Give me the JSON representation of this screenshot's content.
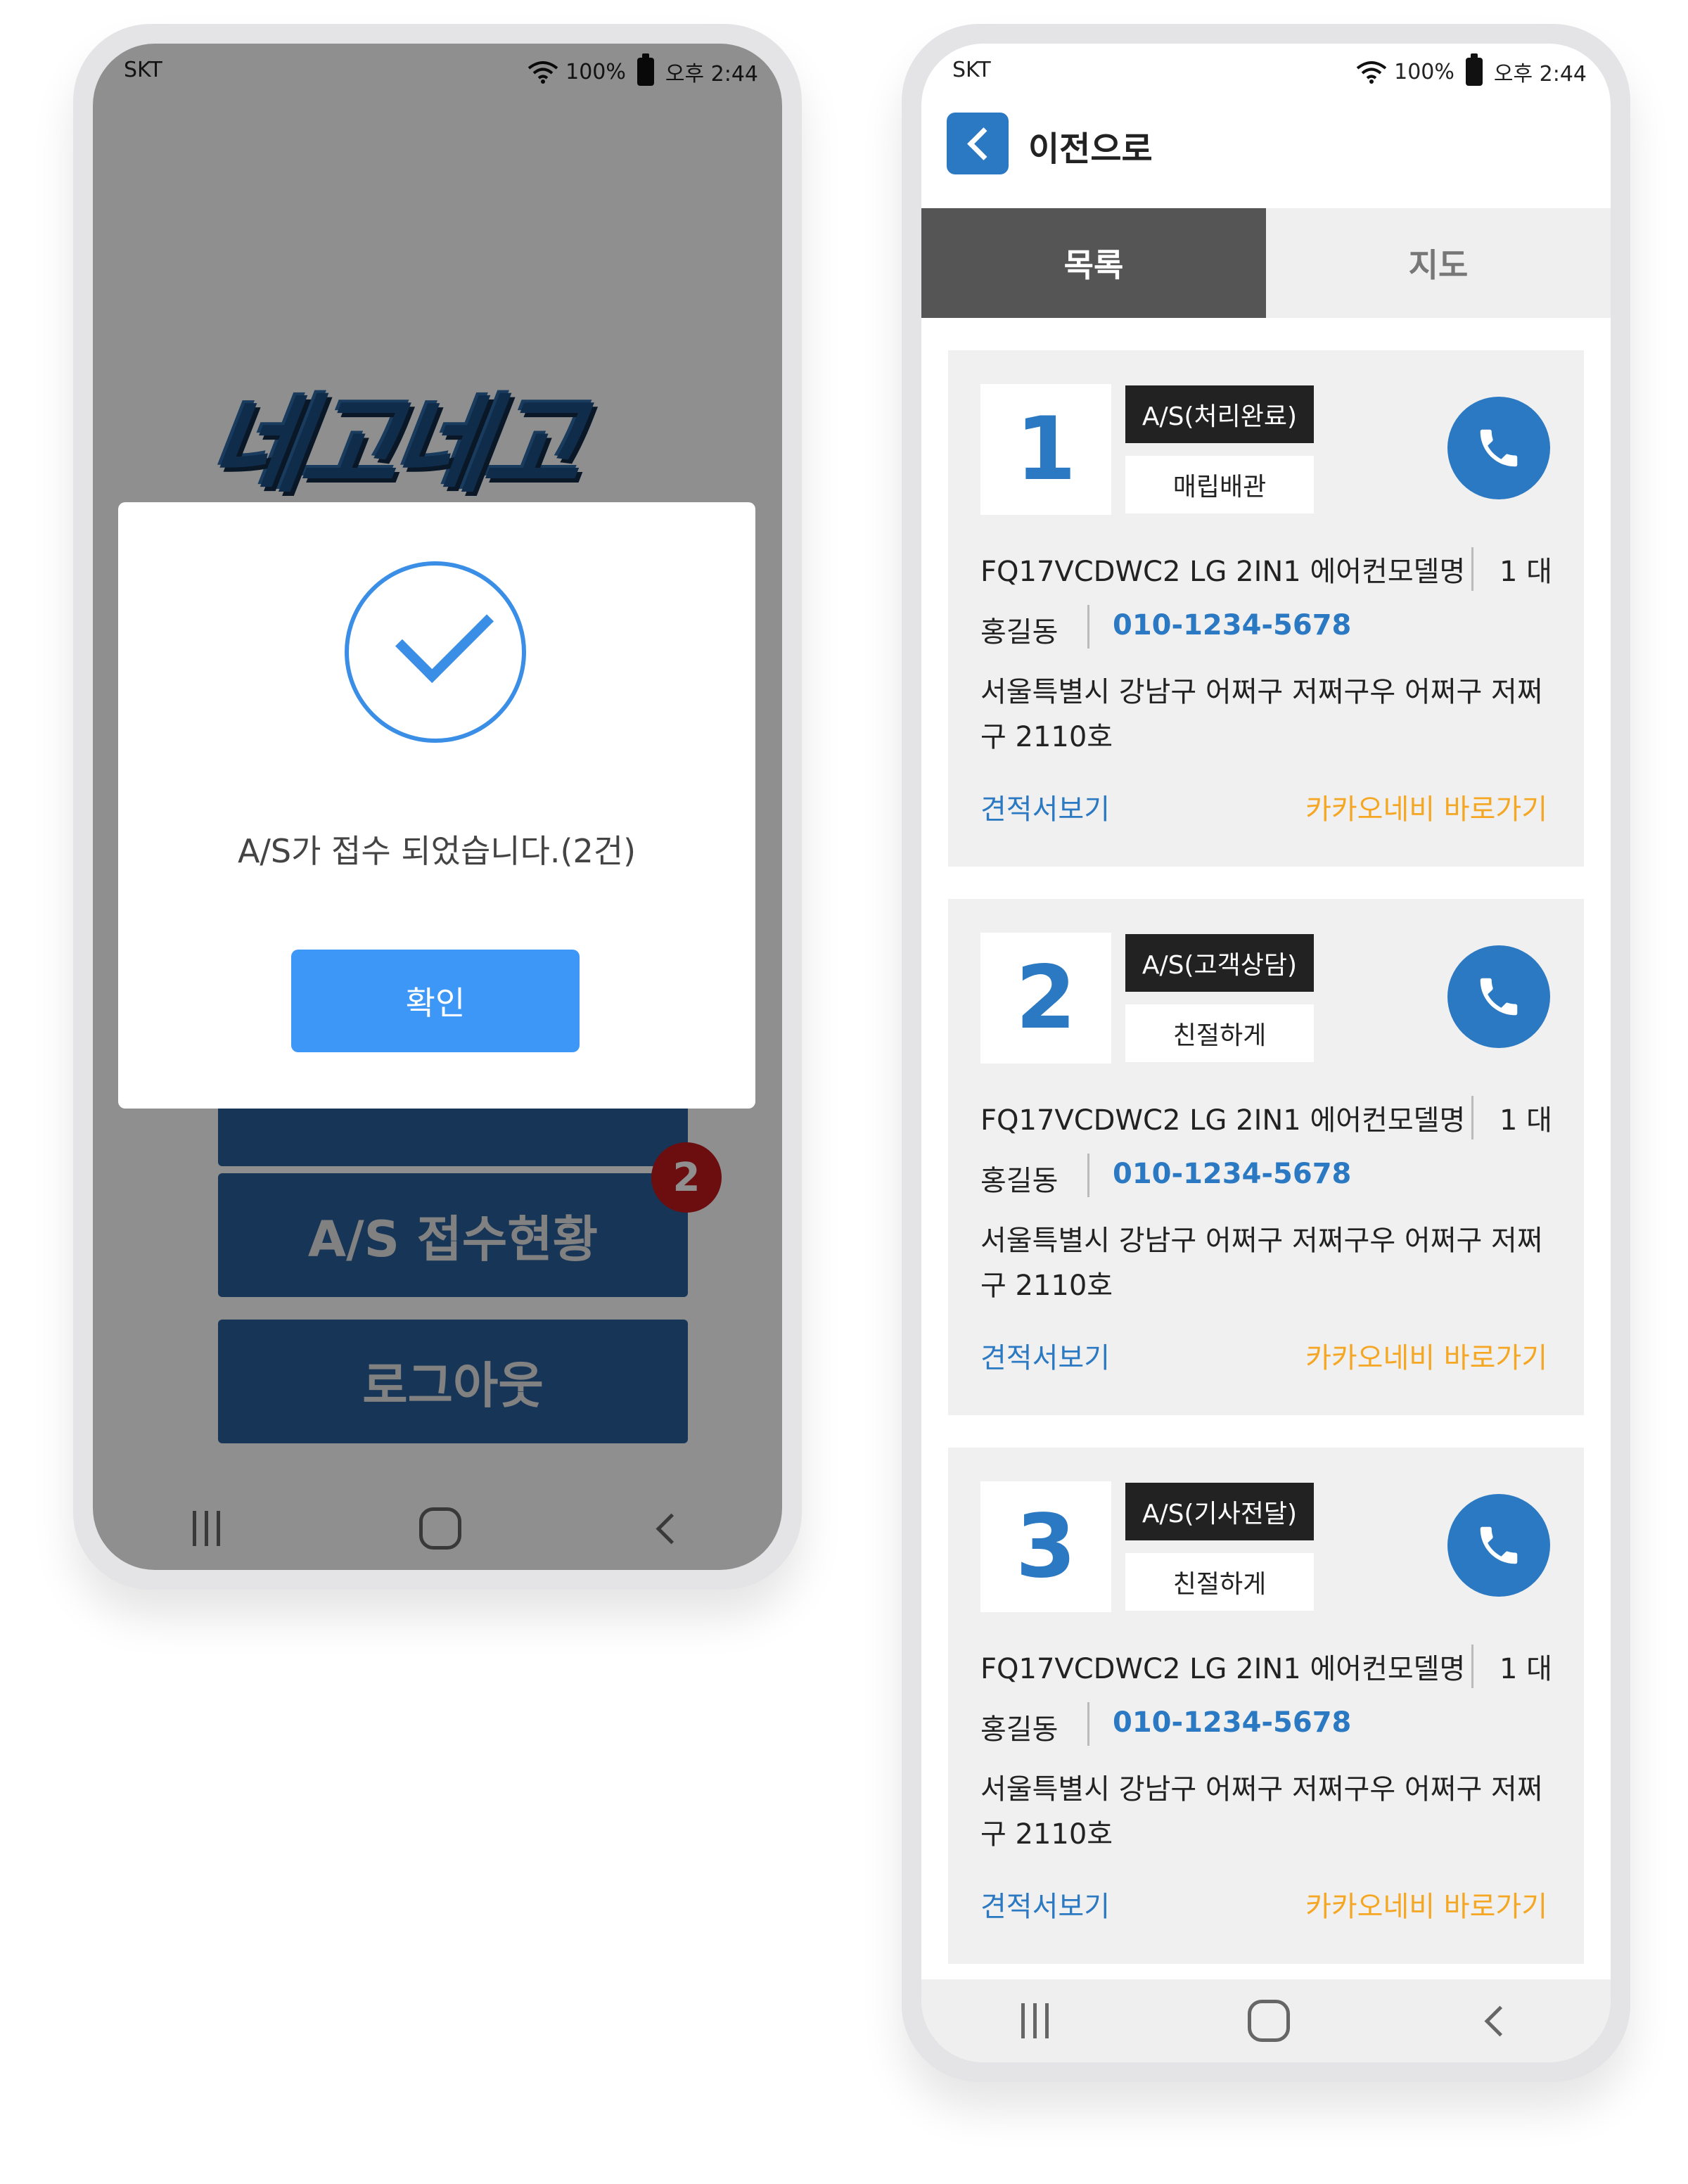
{
  "status_bar": {
    "carrier": "SKT",
    "battery": "100%",
    "time": "오후 2:44"
  },
  "left": {
    "logo": "네고네고",
    "menu": {
      "status_button": "A/S 접수현황",
      "logout_button": "로그아웃",
      "badge_count": "2"
    },
    "dialog": {
      "message": "A/S가 접수 되었습니다.(2건)",
      "confirm_label": "확인"
    }
  },
  "right": {
    "back_label": "이전으로",
    "tabs": [
      {
        "label": "목록"
      },
      {
        "label": "지도"
      }
    ],
    "cards": [
      {
        "number": "1",
        "status": "A/S(처리완료)",
        "type": "매립배관",
        "model": "FQ17VCDWC2 LG 2IN1 에어컨모델명",
        "quantity": "1 대",
        "name": "홍길동",
        "phone": "010-1234-5678",
        "address": "서울특별시 강남구 어쩌구 저쩌구우 어쩌구 저쩌구 2110호",
        "estimate_label": "견적서보기",
        "kakao_label": "카카오네비 바로가기"
      },
      {
        "number": "2",
        "status": "A/S(고객상담)",
        "type": "친절하게",
        "model": "FQ17VCDWC2 LG 2IN1 에어컨모델명",
        "quantity": "1 대",
        "name": "홍길동",
        "phone": "010-1234-5678",
        "address": "서울특별시 강남구 어쩌구 저쩌구우 어쩌구 저쩌구 2110호",
        "estimate_label": "견적서보기",
        "kakao_label": "카카오네비 바로가기"
      },
      {
        "number": "3",
        "status": "A/S(기사전달)",
        "type": "친절하게",
        "model": "FQ17VCDWC2 LG 2IN1 에어컨모델명",
        "quantity": "1 대",
        "name": "홍길동",
        "phone": "010-1234-5678",
        "address": "서울특별시 강남구 어쩌구 저쩌구우 어쩌구 저쩌구 2110호",
        "estimate_label": "견적서보기",
        "kakao_label": "카카오네비 바로가기"
      }
    ]
  },
  "colors": {
    "accent": "#2b79c2",
    "dialog_button": "#3d97f6",
    "badge": "#c0181c",
    "kakao": "#f5a623"
  },
  "icons": [
    "wifi-icon",
    "battery-icon",
    "check-icon",
    "phone-icon",
    "back-chevron-icon",
    "nav-recent-icon",
    "nav-home-icon",
    "nav-back-icon"
  ]
}
